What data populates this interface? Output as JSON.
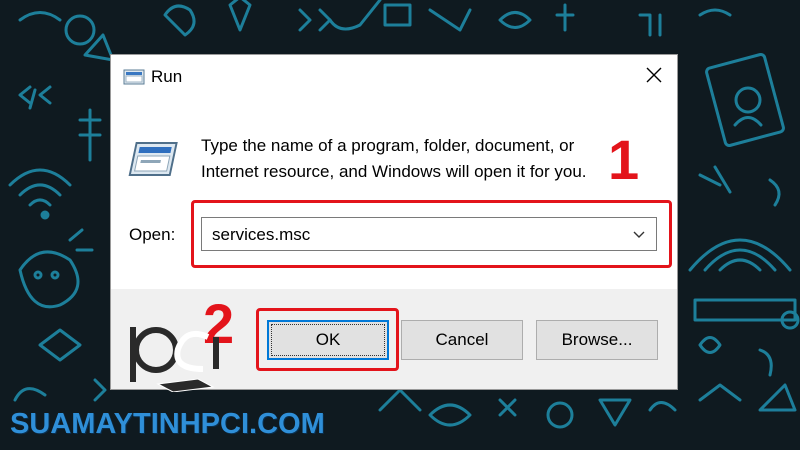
{
  "dialog": {
    "title": "Run",
    "description": "Type the name of a program, folder, document, or Internet resource, and Windows will open it for you.",
    "open_label": "Open:",
    "open_value": "services.msc",
    "buttons": {
      "ok": "OK",
      "cancel": "Cancel",
      "browse": "Browse..."
    }
  },
  "annotations": {
    "step1": "1",
    "step2": "2",
    "highlight_color": "#e3141b"
  },
  "watermark": {
    "text": "SUAMAYTINHPCI.COM",
    "logo_text": "pci"
  },
  "colors": {
    "background": "#0f1a20",
    "doodle": "#1f8aa8",
    "accent_focus": "#0078d7"
  },
  "icons": [
    "run-app-icon",
    "close-icon",
    "program-window-icon",
    "chevron-down-icon",
    "pci-logo-icon"
  ]
}
